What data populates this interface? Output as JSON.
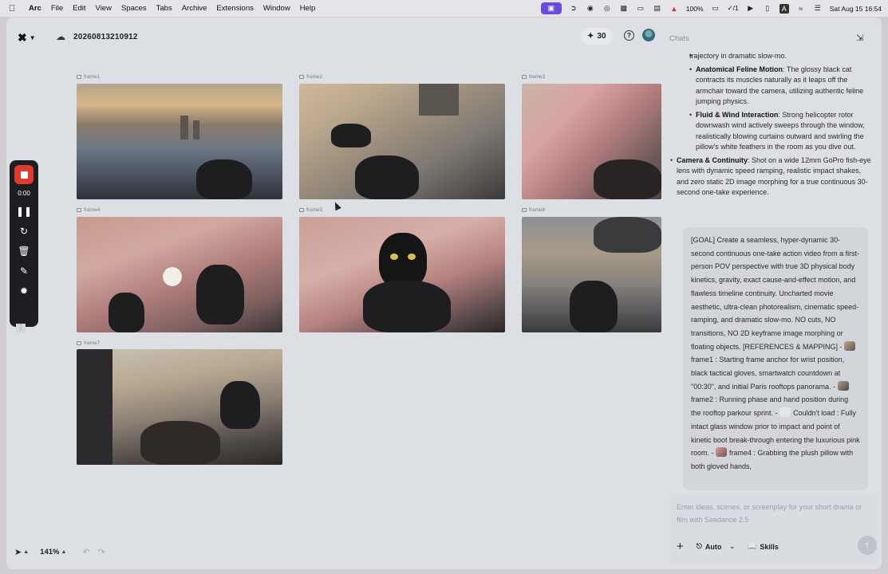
{
  "menubar": {
    "app": "Arc",
    "items": [
      "File",
      "Edit",
      "View",
      "Spaces",
      "Tabs",
      "Archive",
      "Extensions",
      "Window",
      "Help"
    ],
    "battery": "100%",
    "check_count": "1",
    "datetime": "Sat Aug 15  16:54"
  },
  "topbar": {
    "project_name": "20260813210912",
    "credits": "30",
    "help": "?"
  },
  "frames": [
    {
      "label": "frame1"
    },
    {
      "label": "frame2"
    },
    {
      "label": "frame3"
    },
    {
      "label": "frame4"
    },
    {
      "label": "frame5"
    },
    {
      "label": "frame6"
    },
    {
      "label": "frame7"
    }
  ],
  "recorder": {
    "time": "0:00"
  },
  "bottom_tools": {
    "zoom": "141%"
  },
  "chat": {
    "title": "Chats",
    "lines": {
      "trajectory": "trajectory in dramatic slow-mo.",
      "feline_title": "Anatomical Feline Motion",
      "feline_text": ": The glossy black cat contracts its muscles naturally as it leaps off the armchair toward the camera, utilizing authentic feline jumping physics.",
      "wind_title": "Fluid & Wind Interaction",
      "wind_text": ": Strong helicopter rotor downwash wind actively sweeps through the window, realistically blowing curtains outward and swirling the pillow's white feathers in the room as you dive out.",
      "camera_title": "Camera & Continuity",
      "camera_text": ": Shot on a wide 12mm GoPro fish-eye lens with dynamic speed ramping, realistic impact shakes, and zero static 2D image morphing for a true continuous 30-second one-take experience."
    },
    "prompt": {
      "p1": "[GOAL] Create a seamless, hyper-dynamic 30-second continuous one-take action video from a first-person POV perspective with true 3D physical body kinetics, gravity, exact cause-and-effect motion, and flawless timeline continuity. Uncharted movie aesthetic, ultra-clean photorealism, cinematic speed-ramping, and dramatic slow-mo. NO cuts, NO transitions, NO 2D keyframe image morphing or floating objects. [REFERENCES & MAPPING] - ",
      "ref1": "frame1",
      "p2": " : Starting frame anchor for wrist position, black tactical gloves, smartwatch countdown at \"00:30\", and initial Paris rooftops panorama. - ",
      "ref2": "frame2",
      "p3": " : Running phase and hand position during the rooftop parkour sprint. - ",
      "ref3": "Couldn't load",
      "p4": " : Fully intact glass window prior to impact and point of kinetic boot break-through entering the luxurious pink room. - ",
      "ref4": "frame4",
      "p5": " : Grabbing the plush pillow with both gloved hands,"
    },
    "input": {
      "placeholder": "Enter ideas, scenes, or screenplay for your short drama or film with Seedance 2.5",
      "mode": "Auto",
      "skills": "Skills"
    }
  },
  "colors": {
    "record_red": "#e23a2e",
    "menubar_accent": "#6b4ce0"
  }
}
